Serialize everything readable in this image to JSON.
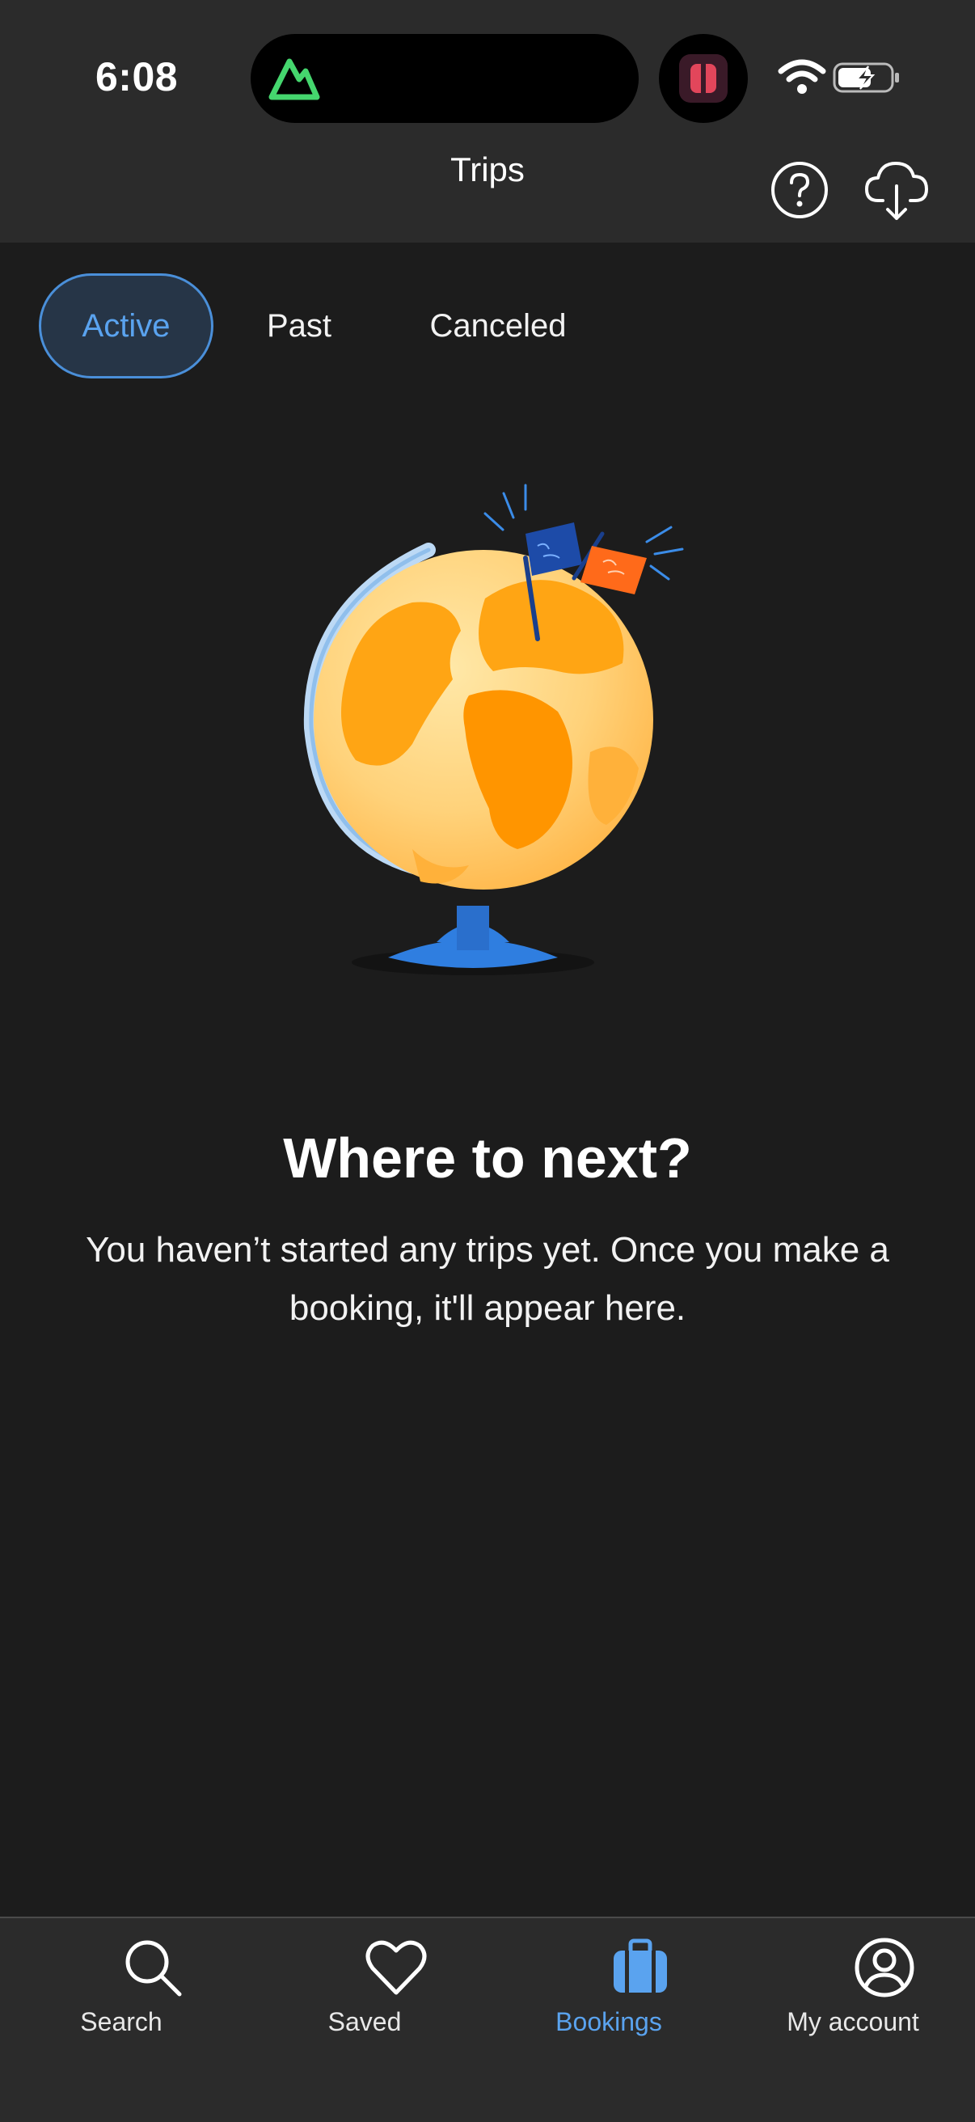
{
  "status_bar": {
    "time": "6:08"
  },
  "header": {
    "title": "Trips",
    "help_icon": "question-circle-icon",
    "download_icon": "cloud-download-icon"
  },
  "tabs": [
    {
      "label": "Active",
      "selected": true
    },
    {
      "label": "Past",
      "selected": false
    },
    {
      "label": "Canceled",
      "selected": false
    }
  ],
  "empty_state": {
    "illustration": "globe-with-flags",
    "title": "Where to next?",
    "message": "You haven’t started any trips yet. Once you make a booking, it'll appear here."
  },
  "bottom_nav": [
    {
      "label": "Search",
      "icon": "search-icon",
      "active": false
    },
    {
      "label": "Saved",
      "icon": "heart-icon",
      "active": false
    },
    {
      "label": "Bookings",
      "icon": "briefcase-icon",
      "active": true
    },
    {
      "label": "My account",
      "icon": "account-icon",
      "active": false
    }
  ],
  "colors": {
    "background": "#1c1c1c",
    "bar_background": "#2b2b2b",
    "accent": "#5aa3ef"
  }
}
